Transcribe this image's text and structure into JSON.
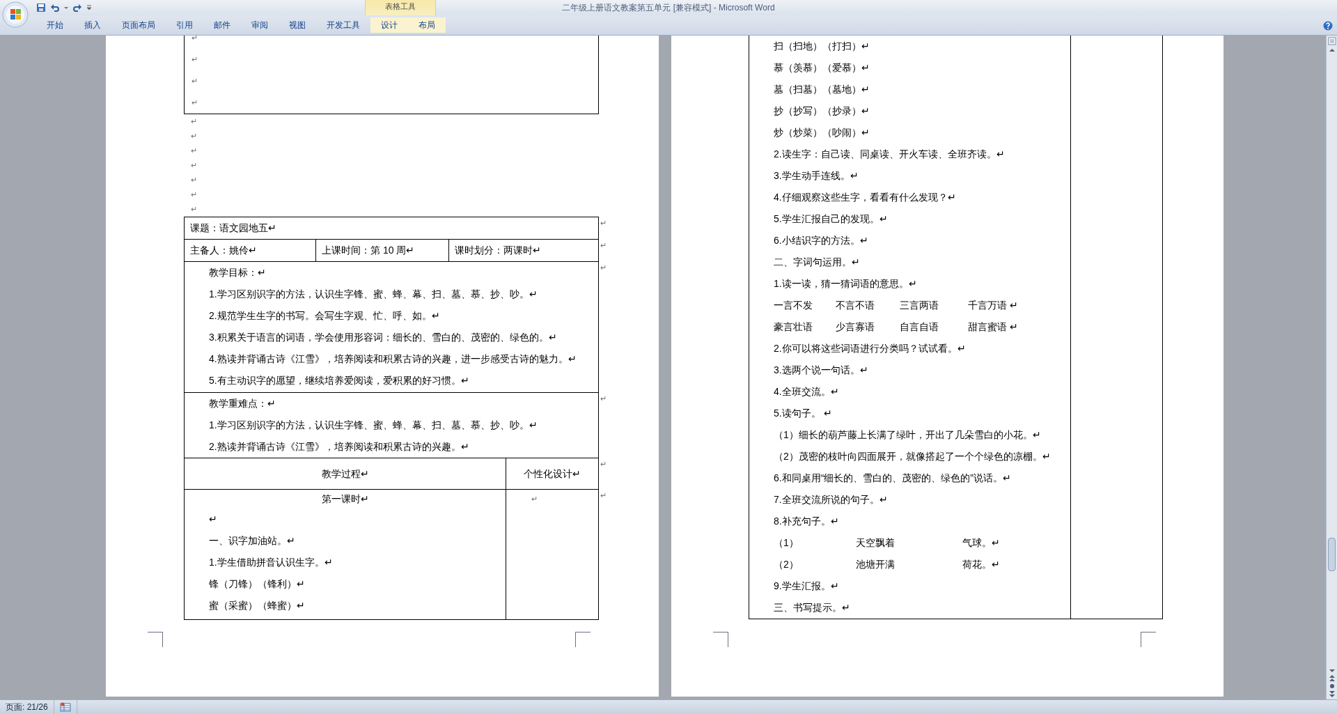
{
  "window": {
    "title": "二年级上册语文教案第五单元 [兼容模式] - Microsoft Word"
  },
  "contextual_group": {
    "label": "表格工具"
  },
  "ribbon_tabs": [
    {
      "label": "开始",
      "selected": false,
      "contextual": false
    },
    {
      "label": "插入",
      "selected": false,
      "contextual": false
    },
    {
      "label": "页面布局",
      "selected": false,
      "contextual": false
    },
    {
      "label": "引用",
      "selected": false,
      "contextual": false
    },
    {
      "label": "邮件",
      "selected": false,
      "contextual": false
    },
    {
      "label": "审阅",
      "selected": false,
      "contextual": false
    },
    {
      "label": "视图",
      "selected": false,
      "contextual": false
    },
    {
      "label": "开发工具",
      "selected": false,
      "contextual": false
    },
    {
      "label": "设计",
      "selected": false,
      "contextual": true
    },
    {
      "label": "布局",
      "selected": false,
      "contextual": true
    }
  ],
  "left_page": {
    "top_table_lines": [
      "↵",
      "↵",
      "↵",
      "↵"
    ],
    "between_lines": [
      "↵",
      "↵",
      "↵",
      "↵",
      "↵",
      "↵",
      "↵"
    ],
    "lesson_table": {
      "topic": {
        "text": "课题：语文园地五↵",
        "row_mark": "↵"
      },
      "info": {
        "cells": [
          "主备人：姚伶↵",
          "上课时间：第 10 周↵",
          "课时划分：两课时↵"
        ],
        "row_mark": "↵"
      },
      "goals": {
        "lines": [
          "教学目标：↵",
          "1.学习区别识字的方法，认识生字锋、蜜、蜂、幕、扫、墓、慕、抄、吵。↵",
          "2.规范学生生字的书写。会写生字观、忙、呼、如。↵",
          "3.积累关于语言的词语，学会使用形容词：细长的、雪白的、茂密的、绿色的。↵",
          "4.熟读并背诵古诗《江雪》，培养阅读和积累古诗的兴趣，进一步感受古诗的魅力。↵",
          "5.有主动识字的愿望，继续培养爱阅读，爱积累的好习惯。↵"
        ],
        "row_mark": "↵"
      },
      "difficulties": {
        "lines": [
          "教学重难点：↵",
          "1.学习区别识字的方法，认识生字锋、蜜、蜂、幕、扫、墓、慕、抄、吵。↵",
          "2.熟读并背诵古诗《江雪》，培养阅读和积累古诗的兴趣。↵"
        ],
        "row_mark": "↵"
      },
      "header": {
        "columns": [
          "教学过程↵",
          "个性化设计↵"
        ],
        "row_mark": "↵"
      },
      "body": {
        "heading": "第一课时↵",
        "lines": [
          "↵",
          "一、识字加油站。↵",
          "1.学生借助拼音认识生字。↵",
          "锋（刀锋）（锋利）↵",
          "蜜（采蜜）（蜂蜜）↵"
        ],
        "side_text": "↵",
        "row_mark": "↵"
      }
    }
  },
  "right_page": {
    "lines": [
      {
        "kind": "text",
        "text": "扫（扫地）（打扫）↵"
      },
      {
        "kind": "text",
        "text": "慕（羡慕）（爱慕）↵"
      },
      {
        "kind": "text",
        "text": "墓（扫墓）（墓地）↵"
      },
      {
        "kind": "text",
        "text": "抄（抄写）（抄录）↵"
      },
      {
        "kind": "text",
        "text": "炒（炒菜）（吵闹）↵"
      },
      {
        "kind": "text",
        "text": "2.读生字：自己读、同桌读、开火车读、全班齐读。↵"
      },
      {
        "kind": "text",
        "text": "3.学生动手连线。↵"
      },
      {
        "kind": "text",
        "text": "4.仔细观察这些生字，看看有什么发现？↵"
      },
      {
        "kind": "text",
        "text": "5.学生汇报自己的发现。↵"
      },
      {
        "kind": "text",
        "text": "6.小结识字的方法。↵"
      },
      {
        "kind": "text",
        "text": "二、字词句运用。↵"
      },
      {
        "kind": "text",
        "text": "1.读一读，猜一猜词语的意思。↵"
      },
      {
        "kind": "word_row",
        "cells": [
          "一言不发",
          "不言不语",
          "三言两语",
          "千言万语 ↵"
        ]
      },
      {
        "kind": "word_row",
        "cells": [
          "豪言壮语",
          "少言寡语",
          "自言自语",
          "甜言蜜语 ↵"
        ]
      },
      {
        "kind": "text",
        "text": "2.你可以将这些词语进行分类吗？试试看。↵"
      },
      {
        "kind": "text",
        "text": "3.选两个说一句话。↵"
      },
      {
        "kind": "text",
        "text": "4.全班交流。↵"
      },
      {
        "kind": "text",
        "text": "5.读句子。 ↵"
      },
      {
        "kind": "text",
        "text": "（1）细长的葫芦藤上长满了绿叶，开出了几朵雪白的小花。↵"
      },
      {
        "kind": "text",
        "text": "（2）茂密的枝叶向四面展开，就像搭起了一个个绿色的凉棚。↵"
      },
      {
        "kind": "text",
        "text": "6.和同桌用“细长的、雪白的、茂密的、绿色的”说话。↵"
      },
      {
        "kind": "text",
        "text": "7.全班交流所说的句子。↵"
      },
      {
        "kind": "text",
        "text": "8.补充句子。↵"
      },
      {
        "kind": "fill_row",
        "cells": [
          "（1）",
          "天空飘着",
          "气球。↵"
        ]
      },
      {
        "kind": "fill_row",
        "cells": [
          "（2）",
          "池塘开满",
          "荷花。↵"
        ]
      },
      {
        "kind": "text",
        "text": "9.学生汇报。↵"
      },
      {
        "kind": "text",
        "text": "三、书写提示。↵"
      }
    ]
  },
  "status_bar": {
    "page": "页面: 21/26"
  }
}
